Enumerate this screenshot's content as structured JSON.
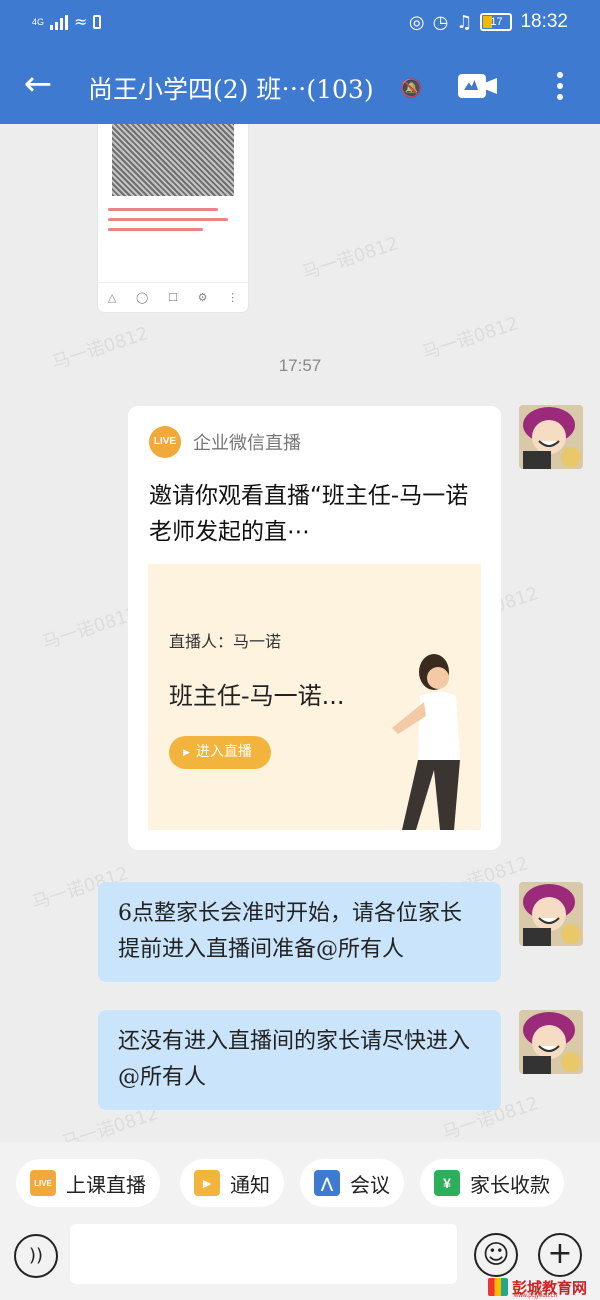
{
  "status_bar": {
    "network": "4G",
    "battery_level": "17",
    "time": "18:32",
    "icons": [
      "signal-icon",
      "wifi-icon",
      "battery-saver-icon",
      "eye-icon",
      "alarm-icon",
      "bell-off-icon",
      "battery-icon"
    ]
  },
  "header": {
    "title": "尚王小学四(2) 班⋯(103)",
    "icons": [
      "back-arrow-icon",
      "mute-bell-icon",
      "video-call-icon",
      "more-vertical-icon"
    ],
    "color": "#3e7ad0"
  },
  "chat": {
    "timestamp": "17:57",
    "watermark": "马一诺0812",
    "live_card": {
      "badge": "LIVE",
      "source": "企业微信直播",
      "invite_text": "邀请你观看直播“班主任-马一诺老师发起的直⋯",
      "host_line": "直播人：马一诺",
      "banner_title": "班主任-马一诺...",
      "enter_button": "进入直播"
    },
    "messages": [
      {
        "text": "6点整家长会准时开始，请各位家长提前进入直播间准备@所有人"
      },
      {
        "text": "还没有进入直播间的家长请尽快进入@所有人"
      }
    ]
  },
  "quick_actions": [
    {
      "label": "上课直播",
      "icon": "live-icon",
      "icon_text": "LIVE",
      "color": "#f0a93a"
    },
    {
      "label": "通知",
      "icon": "megaphone-icon",
      "color": "#f2b43c"
    },
    {
      "label": "会议",
      "icon": "meeting-icon",
      "color": "#3e7ad0"
    },
    {
      "label": "家长收款",
      "icon": "payment-icon",
      "icon_text": "¥",
      "color": "#2cae5a"
    }
  ],
  "input_bar": {
    "icons": [
      "voice-icon",
      "emoji-icon",
      "plus-icon"
    ]
  },
  "brand_mark": {
    "name": "彭城教育网",
    "url": "www.pcjyedu.cn"
  }
}
